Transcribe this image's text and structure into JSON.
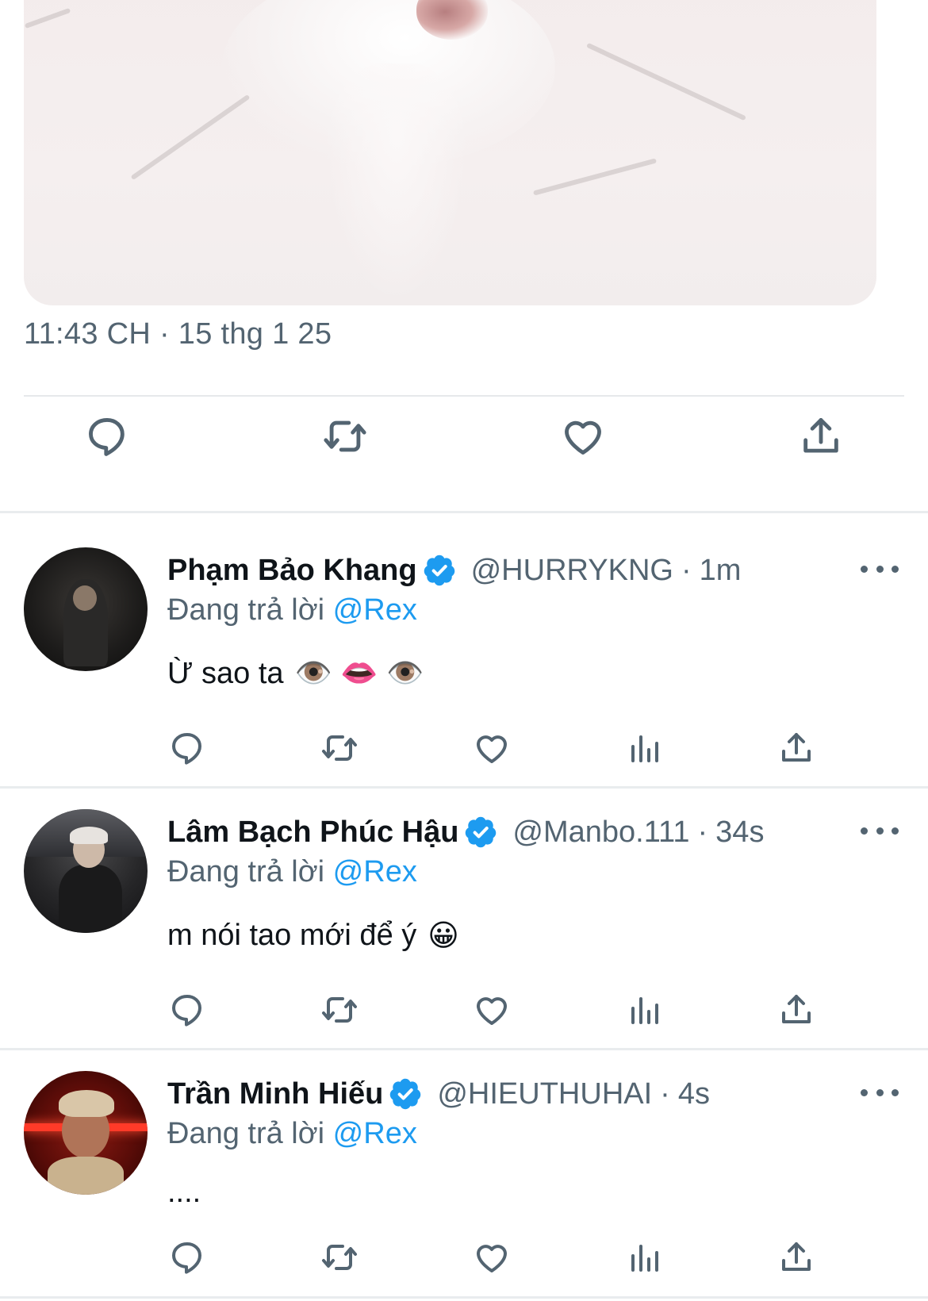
{
  "tweet": {
    "timestamp": "11:43 CH · 15 thg 1 25"
  },
  "main_actions": [
    {
      "icon": "reply-icon"
    },
    {
      "icon": "retweet-icon"
    },
    {
      "icon": "like-icon"
    },
    {
      "icon": "share-icon"
    }
  ],
  "replies": [
    {
      "name": "Phạm Bảo Khang",
      "handle": "@HURRYKNG",
      "separator": "·",
      "time": "1m",
      "replying_prefix": "Đang trả lời",
      "replying_to": "@Rex",
      "text": "Ừ sao ta",
      "emoji": "👁️ 👄 👁️"
    },
    {
      "name": "Lâm Bạch Phúc Hậu",
      "handle": "@Manbo.111",
      "separator": "·",
      "time": "34s",
      "replying_prefix": "Đang trả lời",
      "replying_to": "@Rex",
      "text": "m nói tao mới để ý",
      "emoji": "😀"
    },
    {
      "name": "Trần Minh Hiếu",
      "handle": "@HIEUTHUHAI",
      "separator": "·",
      "time": "4s",
      "replying_prefix": "Đang trả lời",
      "replying_to": "@Rex",
      "text": "....",
      "emoji": ""
    }
  ],
  "colors": {
    "accent": "#1d9bf0",
    "secondary_text": "#536471",
    "primary_text": "#0f1419"
  }
}
